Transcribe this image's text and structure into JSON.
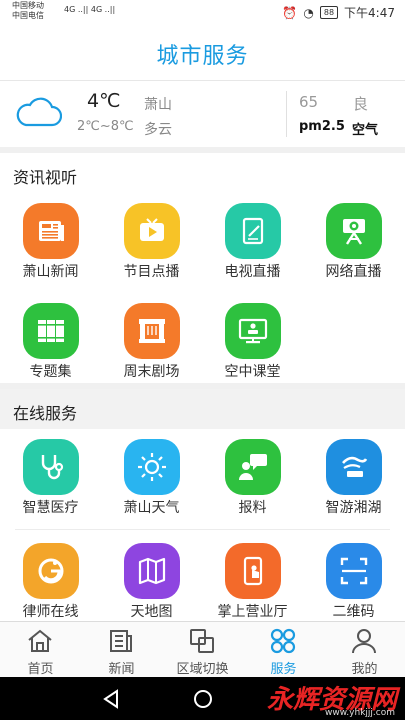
{
  "status_bar": {
    "carrier1": "中国移动",
    "carrier2": "中国电信",
    "signal": "4G ..|| 4G ..||",
    "battery": "88",
    "time": "下午4:47"
  },
  "header": {
    "title": "城市服务"
  },
  "weather": {
    "temperature": "4℃",
    "range": "2℃~8℃",
    "location": "萧山",
    "condition": "多云",
    "aqi_value": "65",
    "aqi_level": "良",
    "pm_label": "pm2.5",
    "air_label": "空气"
  },
  "sections": {
    "media": {
      "title": "资讯视听",
      "items": [
        {
          "label": "萧山新闻",
          "icon": "newspaper-icon",
          "color": "#f47a2a"
        },
        {
          "label": "节目点播",
          "icon": "tv-play-icon",
          "color": "#f7c327"
        },
        {
          "label": "电视直播",
          "icon": "tablet-edit-icon",
          "color": "#26c9a6"
        },
        {
          "label": "网络直播",
          "icon": "camera-tripod-icon",
          "color": "#2ec13f"
        },
        {
          "label": "专题集",
          "icon": "books-icon",
          "color": "#2ec13f"
        },
        {
          "label": "周末剧场",
          "icon": "stage-icon",
          "color": "#f47a2a"
        },
        {
          "label": "空中课堂",
          "icon": "classroom-screen-icon",
          "color": "#2ec13f"
        }
      ]
    },
    "services": {
      "title": "在线服务",
      "items": [
        {
          "label": "智慧医疗",
          "icon": "stethoscope-icon",
          "color": "#26c9a6"
        },
        {
          "label": "萧山天气",
          "icon": "sun-icon",
          "color": "#29b4f0"
        },
        {
          "label": "报料",
          "icon": "report-chat-icon",
          "color": "#2ec13f"
        },
        {
          "label": "智游湘湖",
          "icon": "lake-logo-icon",
          "color": "#1f8fe0"
        },
        {
          "label": "律师在线",
          "icon": "lawyer-logo-icon",
          "color": "#f3a52a"
        },
        {
          "label": "天地图",
          "icon": "map-icon",
          "color": "#8e45e0"
        },
        {
          "label": "掌上营业厅",
          "icon": "phone-touch-icon",
          "color": "#f36a2a"
        },
        {
          "label": "二维码",
          "icon": "qr-scan-icon",
          "color": "#2a8ae8"
        }
      ]
    }
  },
  "bottom_nav": [
    {
      "label": "首页",
      "icon": "home-icon"
    },
    {
      "label": "新闻",
      "icon": "news-icon"
    },
    {
      "label": "区域切换",
      "icon": "region-switch-icon"
    },
    {
      "label": "服务",
      "icon": "service-grid-icon",
      "active": true
    },
    {
      "label": "我的",
      "icon": "profile-icon"
    }
  ],
  "watermark": {
    "text": "永辉资源网",
    "url": "www.yhkjjj.com"
  }
}
